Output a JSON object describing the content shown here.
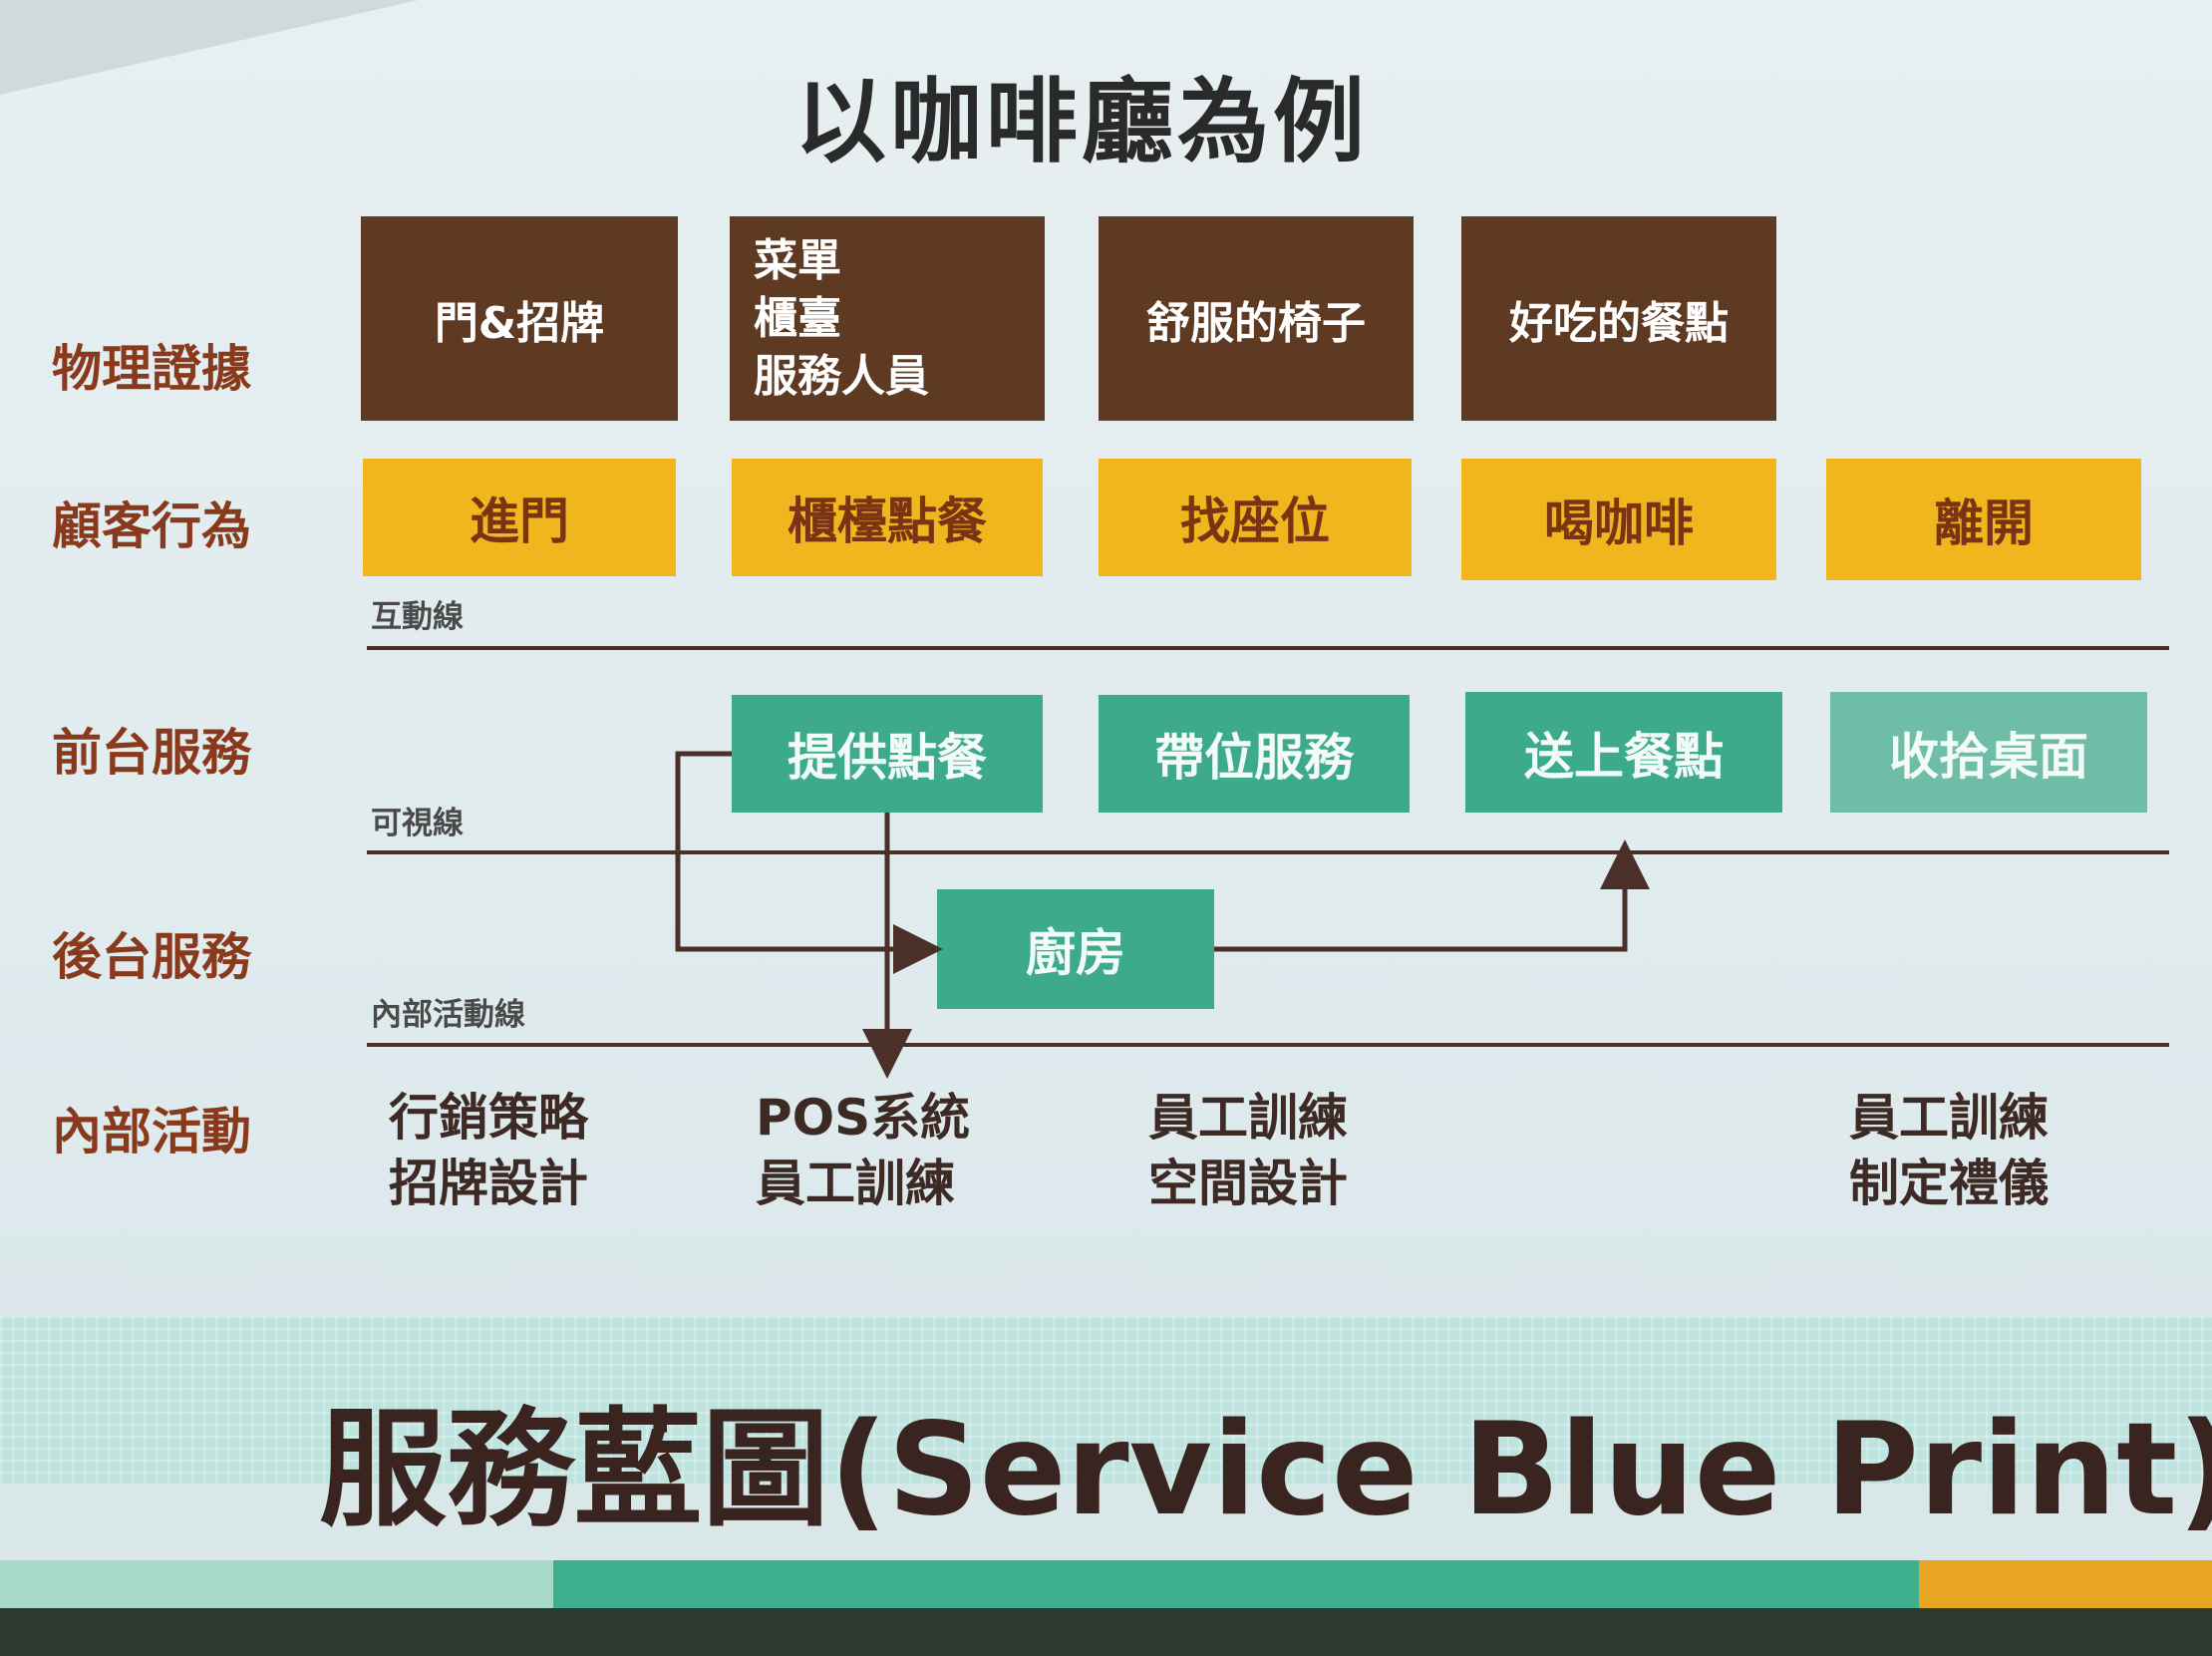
{
  "title": "以咖啡廳為例",
  "row_labels": {
    "physical": "物理證據",
    "customer": "顧客行為",
    "front": "前台服務",
    "back": "後台服務",
    "internal": "內部活動"
  },
  "line_labels": {
    "interaction": "互動線",
    "visibility": "可視線",
    "internal": "內部活動線"
  },
  "physical_evidence": {
    "item1": "門&招牌",
    "item2": [
      "菜單",
      "櫃臺",
      "服務人員"
    ],
    "item3": "舒服的椅子",
    "item4": "好吃的餐點"
  },
  "customer_actions": [
    "進門",
    "櫃檯點餐",
    "找座位",
    "喝咖啡",
    "離開"
  ],
  "front_stage": [
    "提供點餐",
    "帶位服務",
    "送上餐點",
    "收拾桌面"
  ],
  "back_stage": [
    "廚房"
  ],
  "internal_activities": {
    "col1": [
      "行銷策略",
      "招牌設計"
    ],
    "col2": [
      "POS系統",
      "員工訓練"
    ],
    "col3": [
      "員工訓練",
      "空間設計"
    ],
    "col5": [
      "員工訓練",
      "制定禮儀"
    ]
  },
  "footer_title": "服務藍圖(Service Blue Print)",
  "colors": {
    "brown": "#5e3a22",
    "yellow": "#f1b51d",
    "teal": "#3daa8c",
    "label_red": "#8a3a1c"
  }
}
